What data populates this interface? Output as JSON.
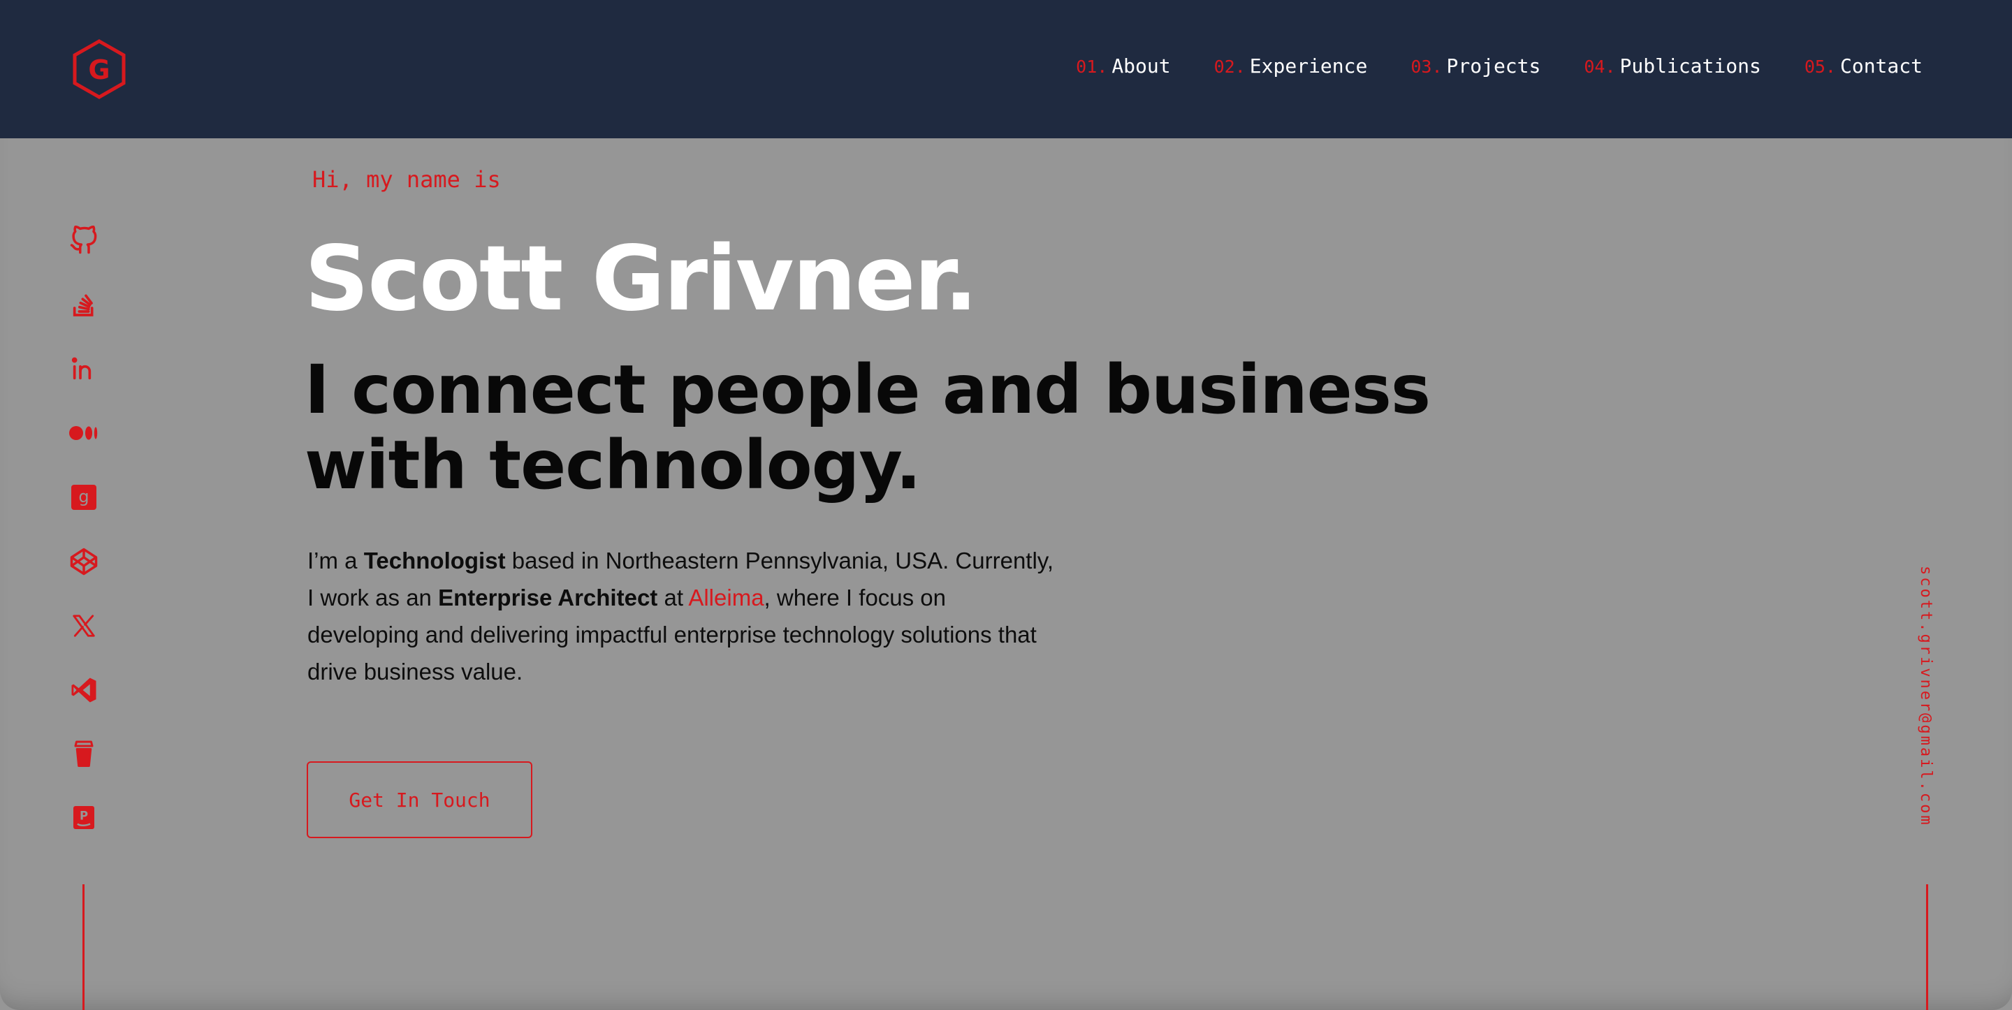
{
  "header": {
    "logo_letter": "G",
    "nav": [
      {
        "num": "01.",
        "label": "About"
      },
      {
        "num": "02.",
        "label": "Experience"
      },
      {
        "num": "03.",
        "label": "Projects"
      },
      {
        "num": "04.",
        "label": "Publications"
      },
      {
        "num": "05.",
        "label": "Contact"
      }
    ]
  },
  "social": [
    {
      "name": "github-icon"
    },
    {
      "name": "stackoverflow-icon"
    },
    {
      "name": "linkedin-icon"
    },
    {
      "name": "medium-icon"
    },
    {
      "name": "goodreads-icon"
    },
    {
      "name": "codepen-icon"
    },
    {
      "name": "x-icon"
    },
    {
      "name": "vscode-icon"
    },
    {
      "name": "buymeacoffee-icon"
    },
    {
      "name": "pypi-icon"
    }
  ],
  "email": "scott.grivner@gmail.com",
  "hero": {
    "greeting": "Hi, my name is",
    "name": "Scott Grivner.",
    "tagline": "I connect people and business with technology.",
    "bio": {
      "p1": "I’m a ",
      "b1": "Technologist",
      "p2": " based in Northeastern Pennsylvania, USA. Currently, I work as an ",
      "b2": "Enterprise Architect",
      "p3": " at ",
      "link": "Alleima",
      "p4": ", where I focus on developing and delivering impactful enterprise technology solutions that drive business value."
    },
    "cta_label": "Get In Touch"
  },
  "colors": {
    "accent": "#d7191e",
    "header_bg": "#1f2a40",
    "page_bg": "#969696",
    "name": "#ffffff",
    "tagline": "#080808"
  }
}
